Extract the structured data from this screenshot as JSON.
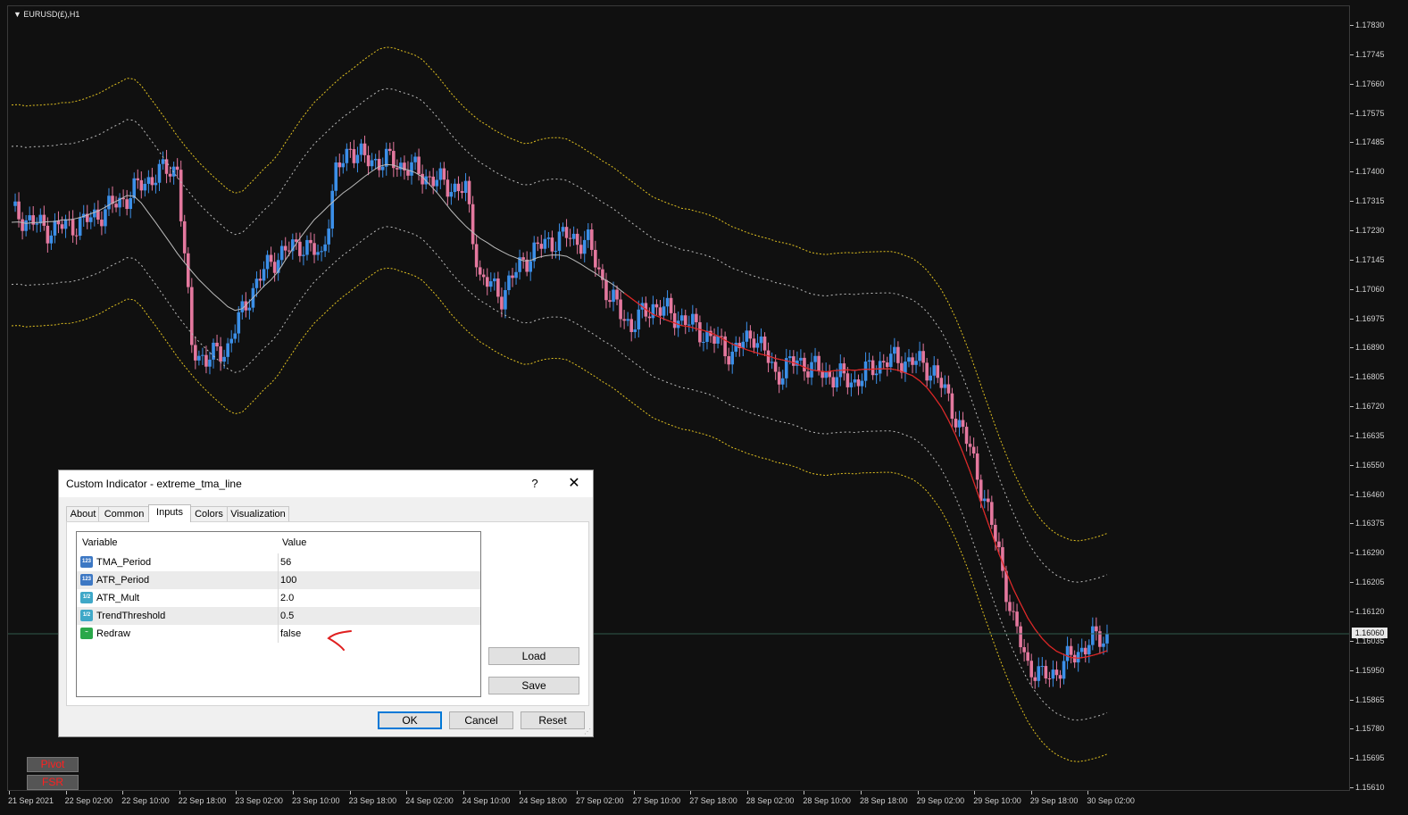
{
  "chart": {
    "symbol": "EURUSD(£),H1",
    "current_price": "1.16060",
    "price_ticks": [
      "1.17830",
      "1.17745",
      "1.17660",
      "1.17575",
      "1.17485",
      "1.17400",
      "1.17315",
      "1.17230",
      "1.17145",
      "1.17060",
      "1.16975",
      "1.16890",
      "1.16805",
      "1.16720",
      "1.16635",
      "1.16550",
      "1.16460",
      "1.16375",
      "1.16290",
      "1.16205",
      "1.16120",
      "1.16035",
      "1.15950",
      "1.15865",
      "1.15780",
      "1.15695",
      "1.15610"
    ],
    "time_ticks": [
      "21 Sep 2021",
      "22 Sep 02:00",
      "22 Sep 10:00",
      "22 Sep 18:00",
      "23 Sep 02:00",
      "23 Sep 10:00",
      "23 Sep 18:00",
      "24 Sep 02:00",
      "24 Sep 10:00",
      "24 Sep 18:00",
      "27 Sep 02:00",
      "27 Sep 10:00",
      "27 Sep 18:00",
      "28 Sep 02:00",
      "28 Sep 10:00",
      "28 Sep 18:00",
      "29 Sep 02:00",
      "29 Sep 10:00",
      "29 Sep 18:00",
      "30 Sep 02:00"
    ],
    "colors": {
      "bull_candle": "#3b8fe8",
      "bear_candle": "#e4789e",
      "band_outer": "#e0c020",
      "band_inner": "#bcbcbc",
      "tma_neutral": "#bcbcbc",
      "tma_up": "#30a040",
      "tma_down": "#e02020"
    }
  },
  "side_buttons": [
    "Pivot",
    "FSR"
  ],
  "dialog": {
    "title": "Custom Indicator - extreme_tma_line",
    "help_label": "?",
    "close_label": "✕",
    "tabs": [
      "About",
      "Common",
      "Inputs",
      "Colors",
      "Visualization"
    ],
    "active_tab": "Inputs",
    "columns": {
      "variable": "Variable",
      "value": "Value"
    },
    "params": [
      {
        "name": "TMA_Period",
        "value": "56",
        "type_icon": "int-icon",
        "icon_text": "123"
      },
      {
        "name": "ATR_Period",
        "value": "100",
        "type_icon": "int-icon",
        "icon_text": "123"
      },
      {
        "name": "ATR_Mult",
        "value": "2.0",
        "type_icon": "double-icon",
        "icon_text": "1/2"
      },
      {
        "name": "TrendThreshold",
        "value": "0.5",
        "type_icon": "double-icon",
        "icon_text": "1/2"
      },
      {
        "name": "Redraw",
        "value": "false",
        "type_icon": "bool-icon",
        "icon_text": "~"
      }
    ],
    "buttons": {
      "load": "Load",
      "save": "Save",
      "ok": "OK",
      "cancel": "Cancel",
      "reset": "Reset"
    }
  }
}
